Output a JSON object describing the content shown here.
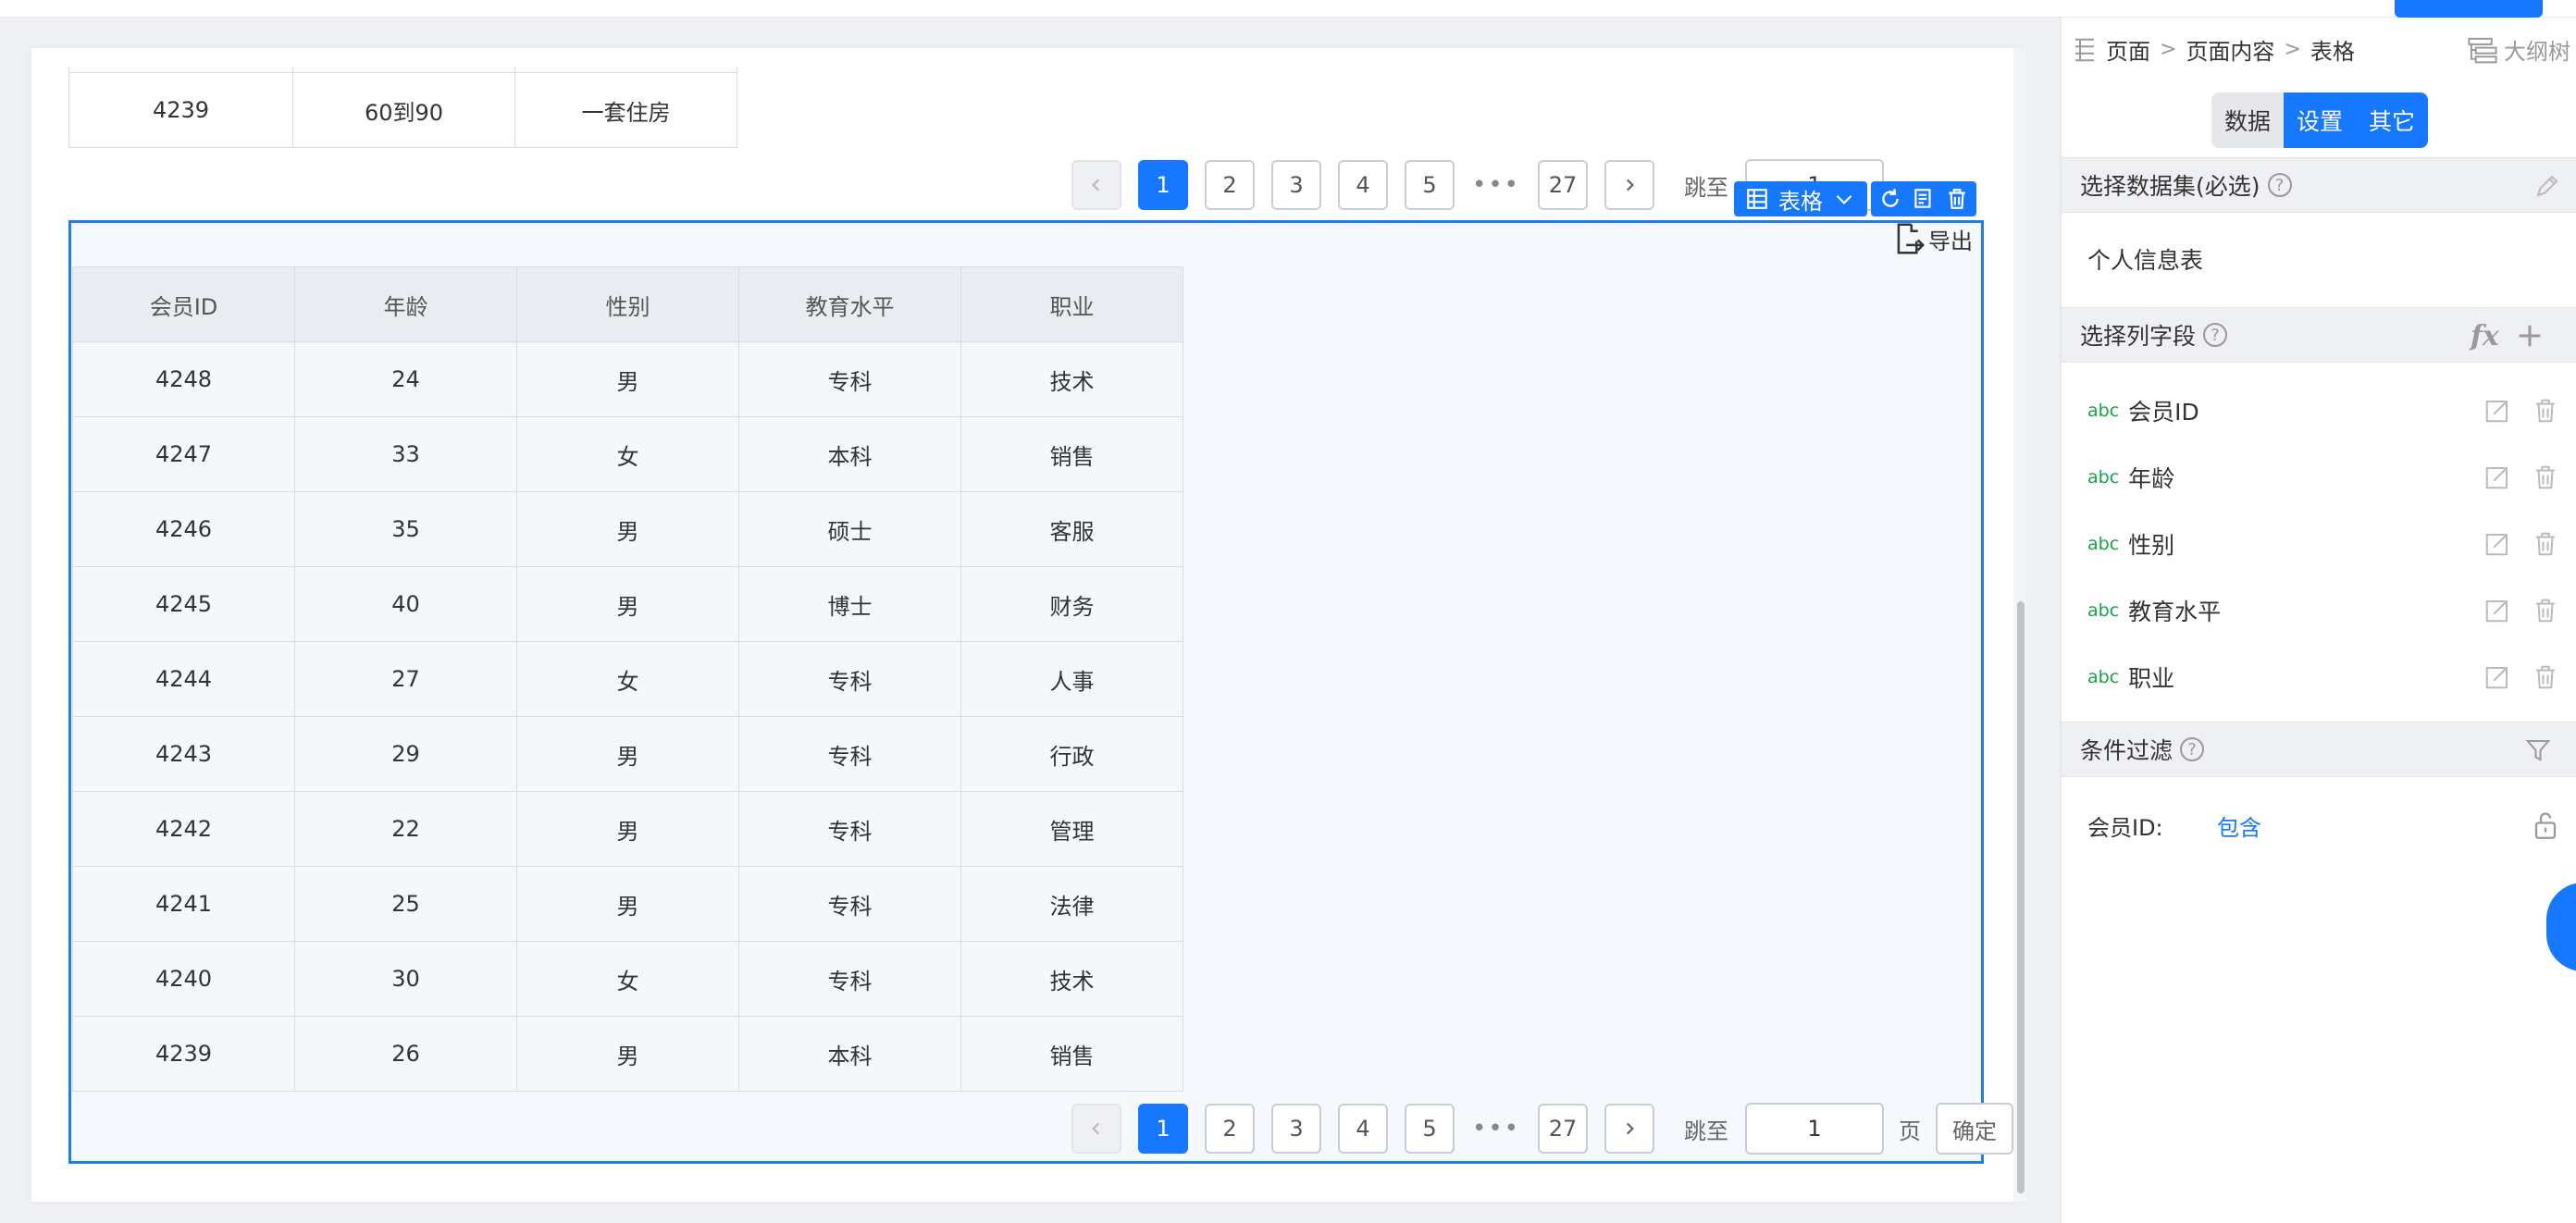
{
  "top_table": {
    "row": [
      "4239",
      "60到90",
      "一套住房"
    ]
  },
  "pagination": {
    "prev_icon": "chevron-left-icon",
    "next_icon": "chevron-right-icon",
    "pages": [
      "1",
      "2",
      "3",
      "4",
      "5"
    ],
    "ellipsis": "•••",
    "last": "27",
    "active_page": "1",
    "jump_label": "跳至",
    "jump_value": "1",
    "page_suffix": "页",
    "confirm_label": "确定"
  },
  "toolbar": {
    "component_label": "表格",
    "icons": [
      "table-icon",
      "chevron-down-icon",
      "refresh-icon",
      "copy-icon",
      "delete-icon"
    ],
    "export_label": "导出"
  },
  "table": {
    "columns": [
      "会员ID",
      "年龄",
      "性别",
      "教育水平",
      "职业"
    ],
    "rows": [
      [
        "4248",
        "24",
        "男",
        "专科",
        "技术"
      ],
      [
        "4247",
        "33",
        "女",
        "本科",
        "销售"
      ],
      [
        "4246",
        "35",
        "男",
        "硕士",
        "客服"
      ],
      [
        "4245",
        "40",
        "男",
        "博士",
        "财务"
      ],
      [
        "4244",
        "27",
        "女",
        "专科",
        "人事"
      ],
      [
        "4243",
        "29",
        "男",
        "专科",
        "行政"
      ],
      [
        "4242",
        "22",
        "男",
        "专科",
        "管理"
      ],
      [
        "4241",
        "25",
        "男",
        "专科",
        "法律"
      ],
      [
        "4240",
        "30",
        "女",
        "专科",
        "技术"
      ],
      [
        "4239",
        "26",
        "男",
        "本科",
        "销售"
      ]
    ]
  },
  "panel": {
    "breadcrumb": [
      "页面",
      "页面内容",
      "表格"
    ],
    "breadcrumb_sep": ">",
    "outline_label": "大纲树",
    "tabs": [
      "数据",
      "设置",
      "其它"
    ],
    "dataset_section": {
      "title": "选择数据集(必选)",
      "help": "?",
      "value": "个人信息表"
    },
    "fields_section": {
      "title": "选择列字段",
      "help": "?",
      "fx": "fx",
      "type_tag": "abc",
      "fields": [
        "会员ID",
        "年龄",
        "性别",
        "教育水平",
        "职业"
      ]
    },
    "filter_section": {
      "title": "条件过滤",
      "help": "?",
      "field_label": "会员ID:",
      "operator": "包含"
    }
  },
  "colors": {
    "accent": "#1677ff",
    "selection_border": "#1f7fe8",
    "type_tag": "#16a34a"
  }
}
